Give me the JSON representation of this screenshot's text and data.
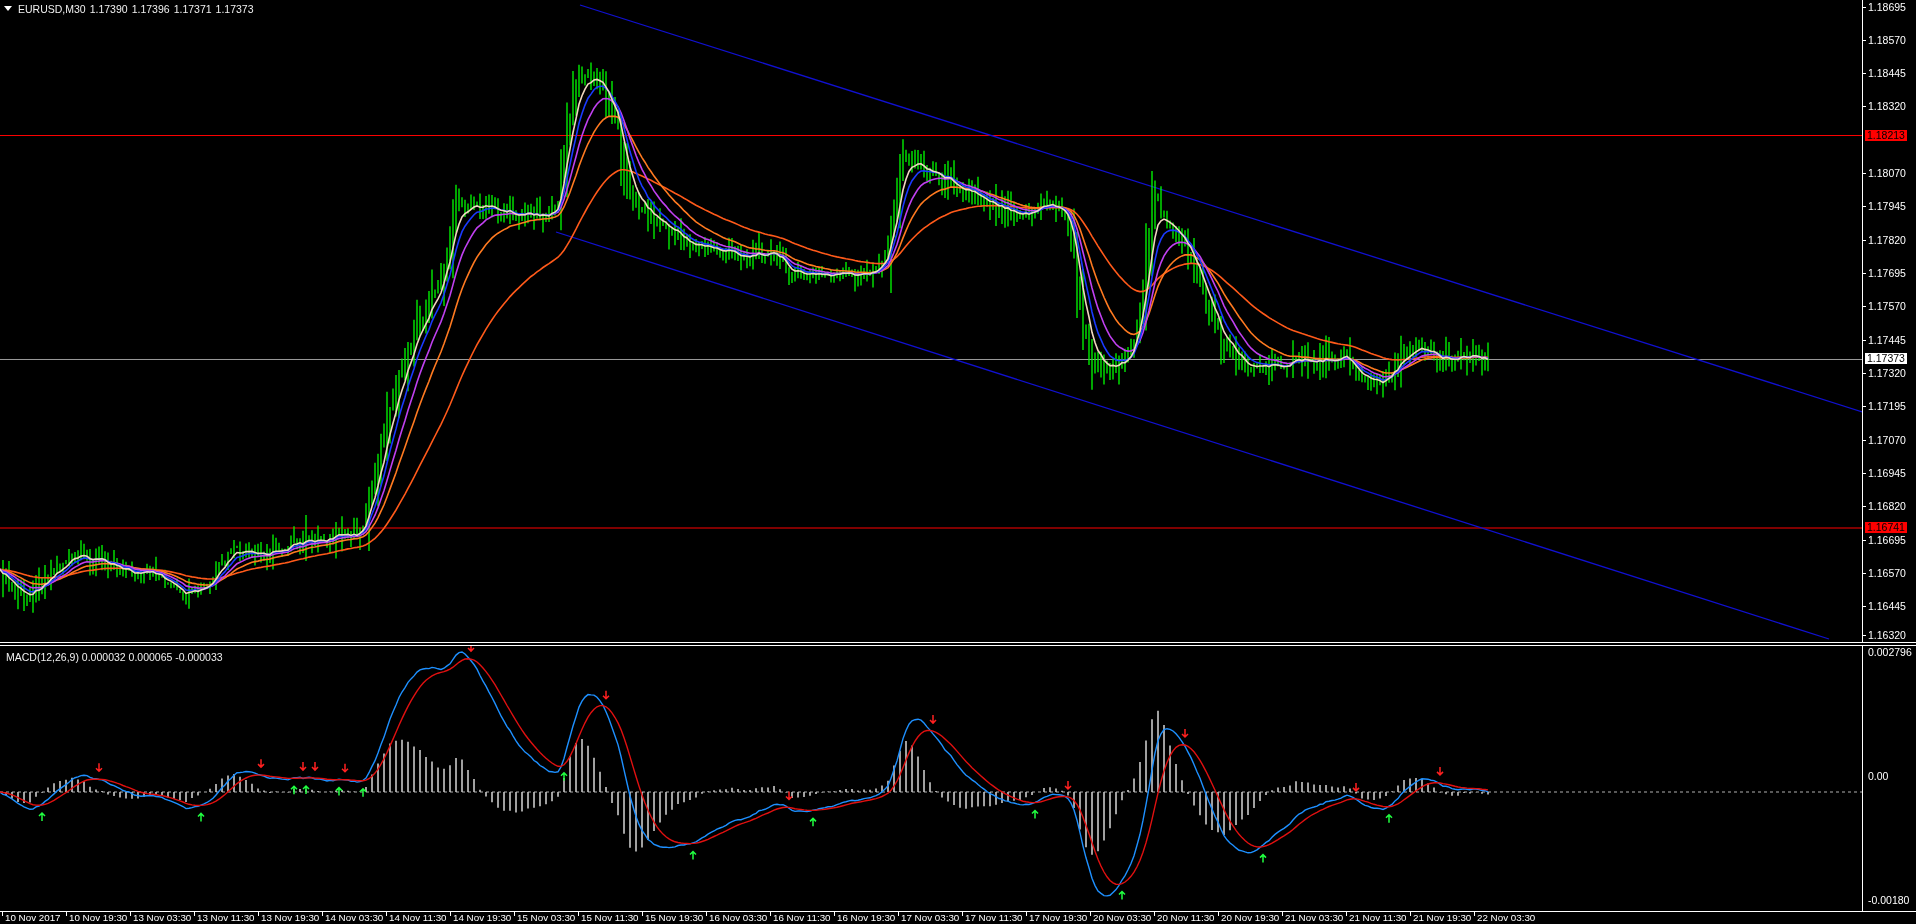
{
  "chart": {
    "symbol": "EURUSD,M30",
    "ohlc": [
      "1.17390",
      "1.17396",
      "1.17371",
      "1.17373"
    ],
    "price_axis": [
      "1.18695",
      "1.18570",
      "1.18445",
      "1.18320",
      "1.18070",
      "1.17945",
      "1.17820",
      "1.17695",
      "1.17570",
      "1.17445",
      "1.17320",
      "1.17195",
      "1.17070",
      "1.16945",
      "1.16820",
      "1.16695",
      "1.16570",
      "1.16445",
      "1.16320"
    ],
    "price_tags": [
      {
        "value": "1.18213",
        "kind": "level"
      },
      {
        "value": "1.17373",
        "kind": "bid"
      },
      {
        "value": "1.16741",
        "kind": "level"
      }
    ]
  },
  "macd": {
    "label": "MACD(12,26,9) 0.000032 0.000065 -0.000033",
    "axis": [
      "0.002796",
      "0.00",
      "-0.00180"
    ]
  },
  "time_axis": [
    "10 Nov 2017",
    "10 Nov 19:30",
    "13 Nov 03:30",
    "13 Nov 11:30",
    "13 Nov 19:30",
    "14 Nov 03:30",
    "14 Nov 11:30",
    "14 Nov 19:30",
    "15 Nov 03:30",
    "15 Nov 11:30",
    "15 Nov 19:30",
    "16 Nov 03:30",
    "16 Nov 11:30",
    "16 Nov 19:30",
    "17 Nov 03:30",
    "17 Nov 11:30",
    "17 Nov 19:30",
    "20 Nov 03:30",
    "20 Nov 11:30",
    "20 Nov 19:30",
    "21 Nov 03:30",
    "21 Nov 11:30",
    "21 Nov 19:30",
    "22 Nov 03:30"
  ]
}
